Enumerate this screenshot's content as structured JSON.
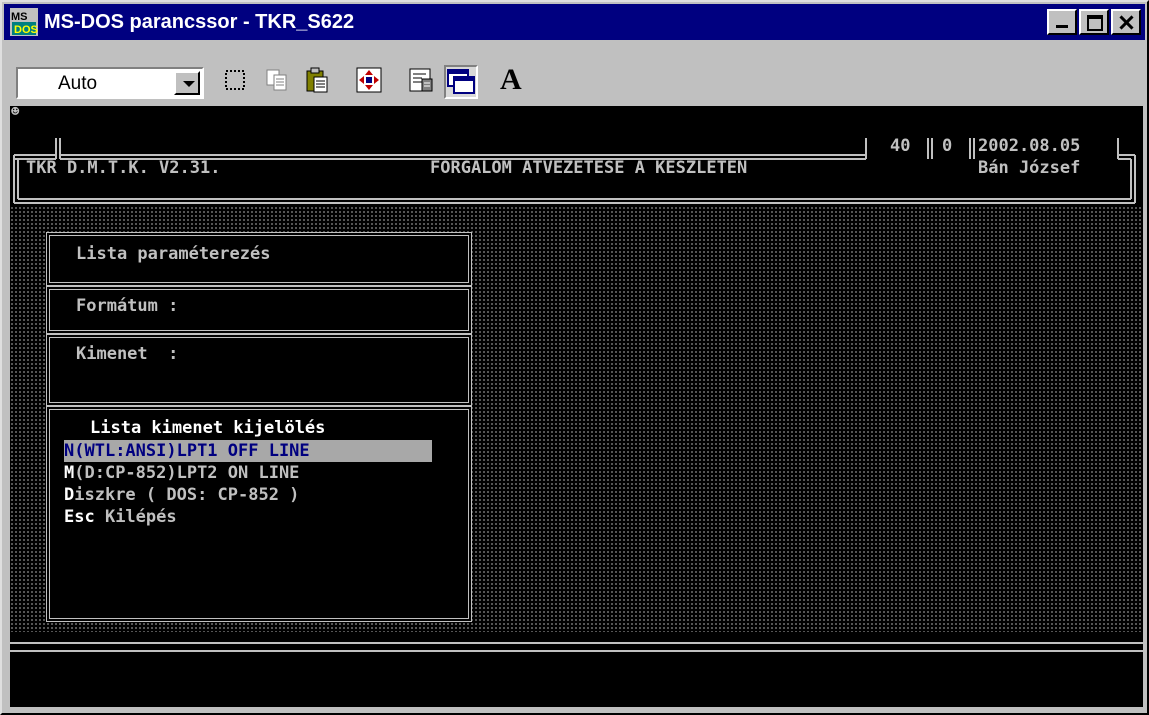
{
  "window": {
    "title": "MS-DOS parancssor - TKR_S622",
    "icon": "ms-dos-icon"
  },
  "toolbar": {
    "font_size_value": "Auto",
    "buttons": [
      "mark-icon",
      "copy-icon",
      "paste-icon",
      "fullscreen-icon",
      "properties-icon",
      "background-icon",
      "font-icon"
    ],
    "font_button_label": "A"
  },
  "console": {
    "smiley": "☻",
    "header": {
      "app": "TKR D.M.T.K. V2.31.",
      "function": "FORGALOM ATVEZETESE A KESZLETEN",
      "count1": "40",
      "count2": "0",
      "date": "2002.08.05",
      "user": "Bán József"
    },
    "panel": {
      "title": "Lista paraméterezés",
      "format_label": "Formátum :",
      "output_label": "Kimenet  :",
      "menu_title": "Lista kimenet kijelölés",
      "items": [
        {
          "key": "N",
          "text": "(WTL:ANSI)LPT1 OFF LINE",
          "selected": true
        },
        {
          "key": "M",
          "text": "(D:CP-852)LPT2 ON LINE",
          "selected": false
        },
        {
          "key": "D",
          "text": "iszkre ( DOS: CP-852 )",
          "selected": false
        },
        {
          "key": "Esc",
          "text": " Kilépés",
          "selected": false
        }
      ]
    }
  },
  "colors": {
    "titlebar": "#000080",
    "highlight_bg": "#a8a8a8",
    "highlight_fg": "#000080",
    "text": "#c0c0c0"
  }
}
